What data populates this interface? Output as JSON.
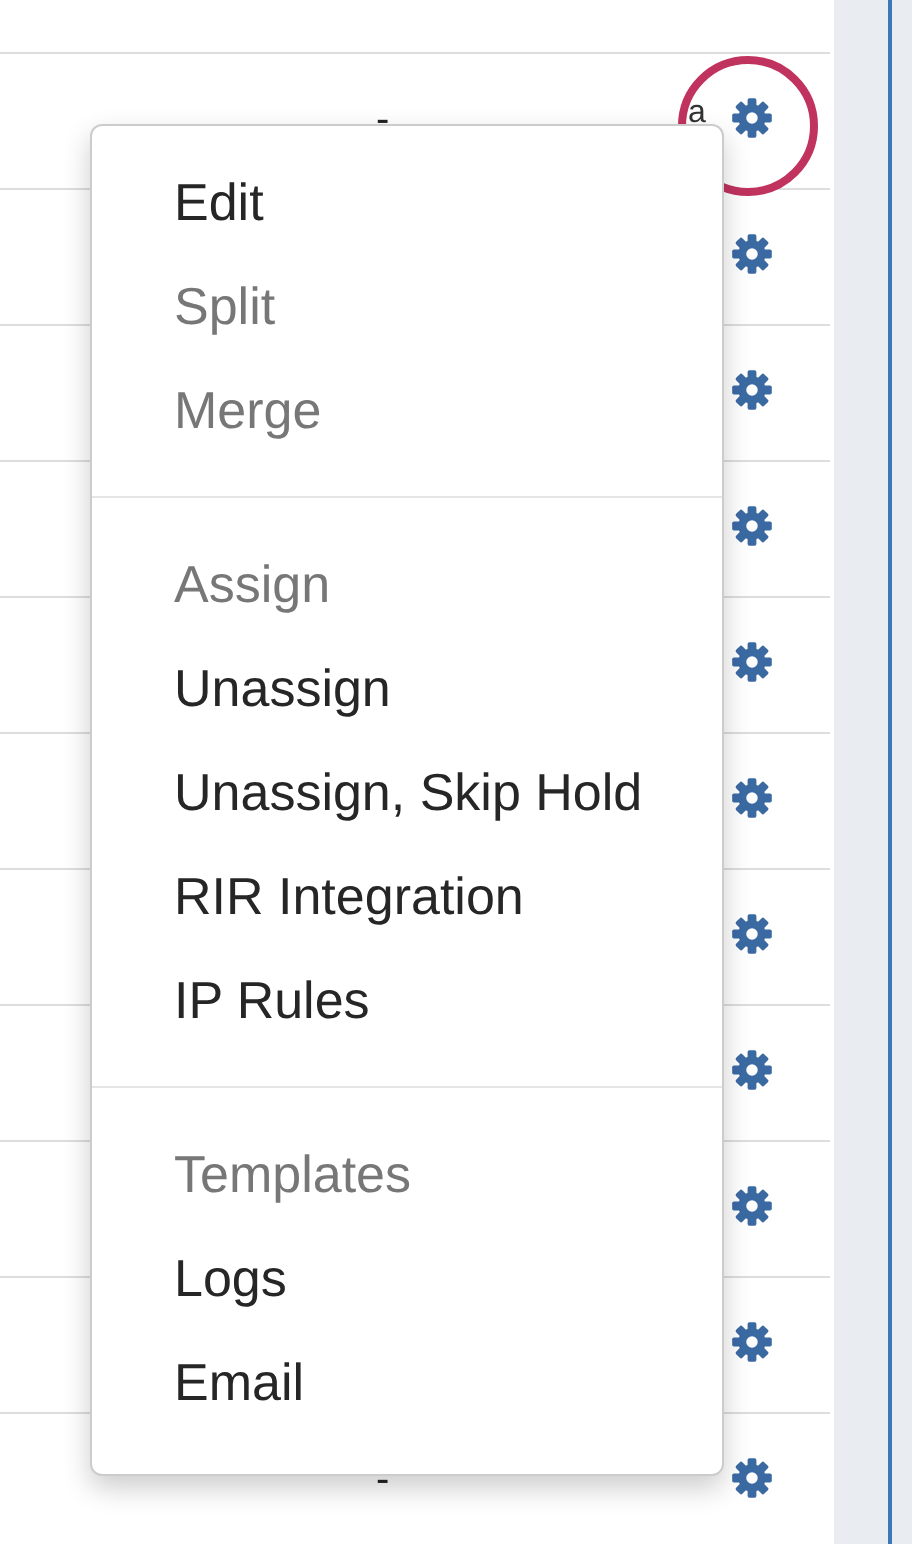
{
  "table": {
    "rows": [
      {
        "value": "-",
        "marker": "a",
        "highlighted": true
      },
      {
        "highlighted": false
      },
      {
        "highlighted": false
      },
      {
        "highlighted": false
      },
      {
        "highlighted": false
      },
      {
        "highlighted": false
      },
      {
        "highlighted": false
      },
      {
        "highlighted": false
      },
      {
        "highlighted": false
      },
      {
        "highlighted": false
      },
      {
        "value": "-",
        "highlighted": false
      }
    ]
  },
  "context_menu": {
    "groups": [
      {
        "items": [
          {
            "label": "Edit",
            "disabled": false
          },
          {
            "label": "Split",
            "disabled": true
          },
          {
            "label": "Merge",
            "disabled": true
          }
        ]
      },
      {
        "items": [
          {
            "label": "Assign",
            "disabled": true
          },
          {
            "label": "Unassign",
            "disabled": false
          },
          {
            "label": "Unassign, Skip Hold",
            "disabled": false
          },
          {
            "label": "RIR Integration",
            "disabled": false
          },
          {
            "label": "IP Rules",
            "disabled": false
          }
        ]
      },
      {
        "items": [
          {
            "label": "Templates",
            "disabled": true
          },
          {
            "label": "Logs",
            "disabled": false
          },
          {
            "label": "Email",
            "disabled": false
          }
        ]
      }
    ]
  }
}
